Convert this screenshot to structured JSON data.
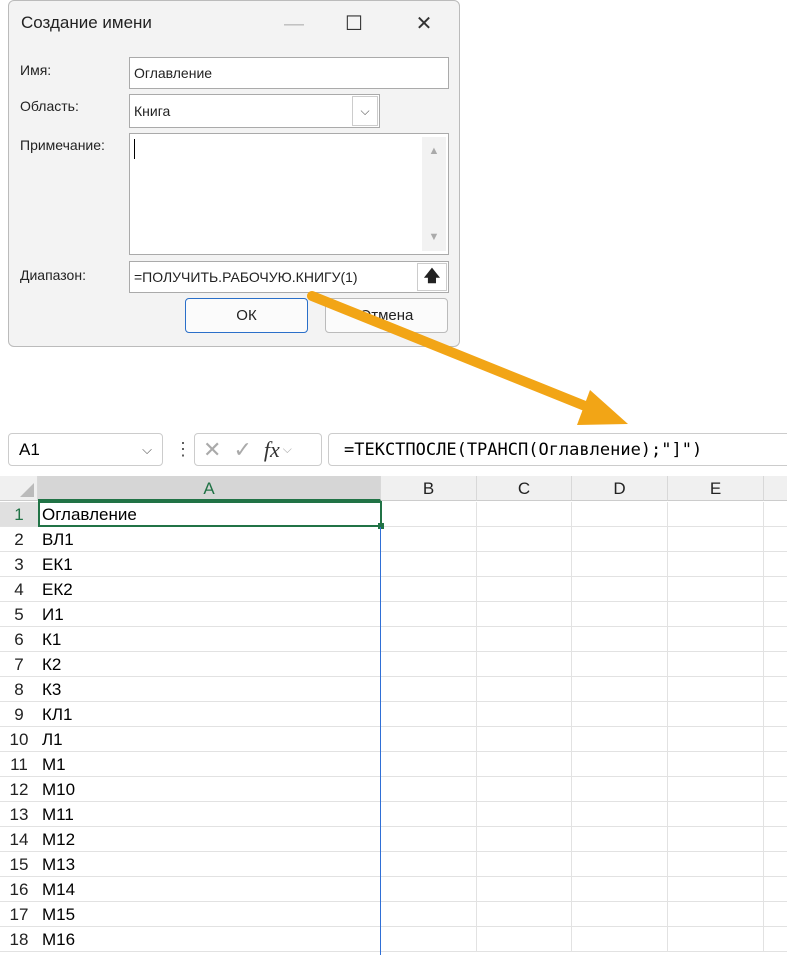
{
  "dialog": {
    "title": "Создание имени",
    "name_label": "Имя:",
    "name_value": "Оглавление",
    "scope_label": "Область:",
    "scope_value": "Книга",
    "comment_label": "Примечание:",
    "comment_value": "",
    "range_label": "Диапазон:",
    "range_value": "=ПОЛУЧИТЬ.РАБОЧУЮ.КНИГУ(1)",
    "ok_label": "ОК",
    "cancel_label": "Отмена"
  },
  "formula_bar": {
    "name_box": "A1",
    "formula": "=ТЕКСТПОСЛЕ(ТРАНСП(Оглавление);\"]\")",
    "fx": "fx"
  },
  "sheet": {
    "columns": [
      "A",
      "B",
      "C",
      "D",
      "E"
    ],
    "rows": [
      "1",
      "2",
      "3",
      "4",
      "5",
      "6",
      "7",
      "8",
      "9",
      "10",
      "11",
      "12",
      "13",
      "14",
      "15",
      "16",
      "17",
      "18"
    ],
    "colA": [
      "Оглавление",
      "ВЛ1",
      "ЕК1",
      "ЕК2",
      "И1",
      "К1",
      "К2",
      "К3",
      "КЛ1",
      "Л1",
      "М1",
      "М10",
      "М11",
      "М12",
      "М13",
      "М14",
      "М15",
      "М16"
    ]
  },
  "colors": {
    "arrow": "#F2A516",
    "selection": "#217346",
    "spill": "#2F6FD6"
  }
}
